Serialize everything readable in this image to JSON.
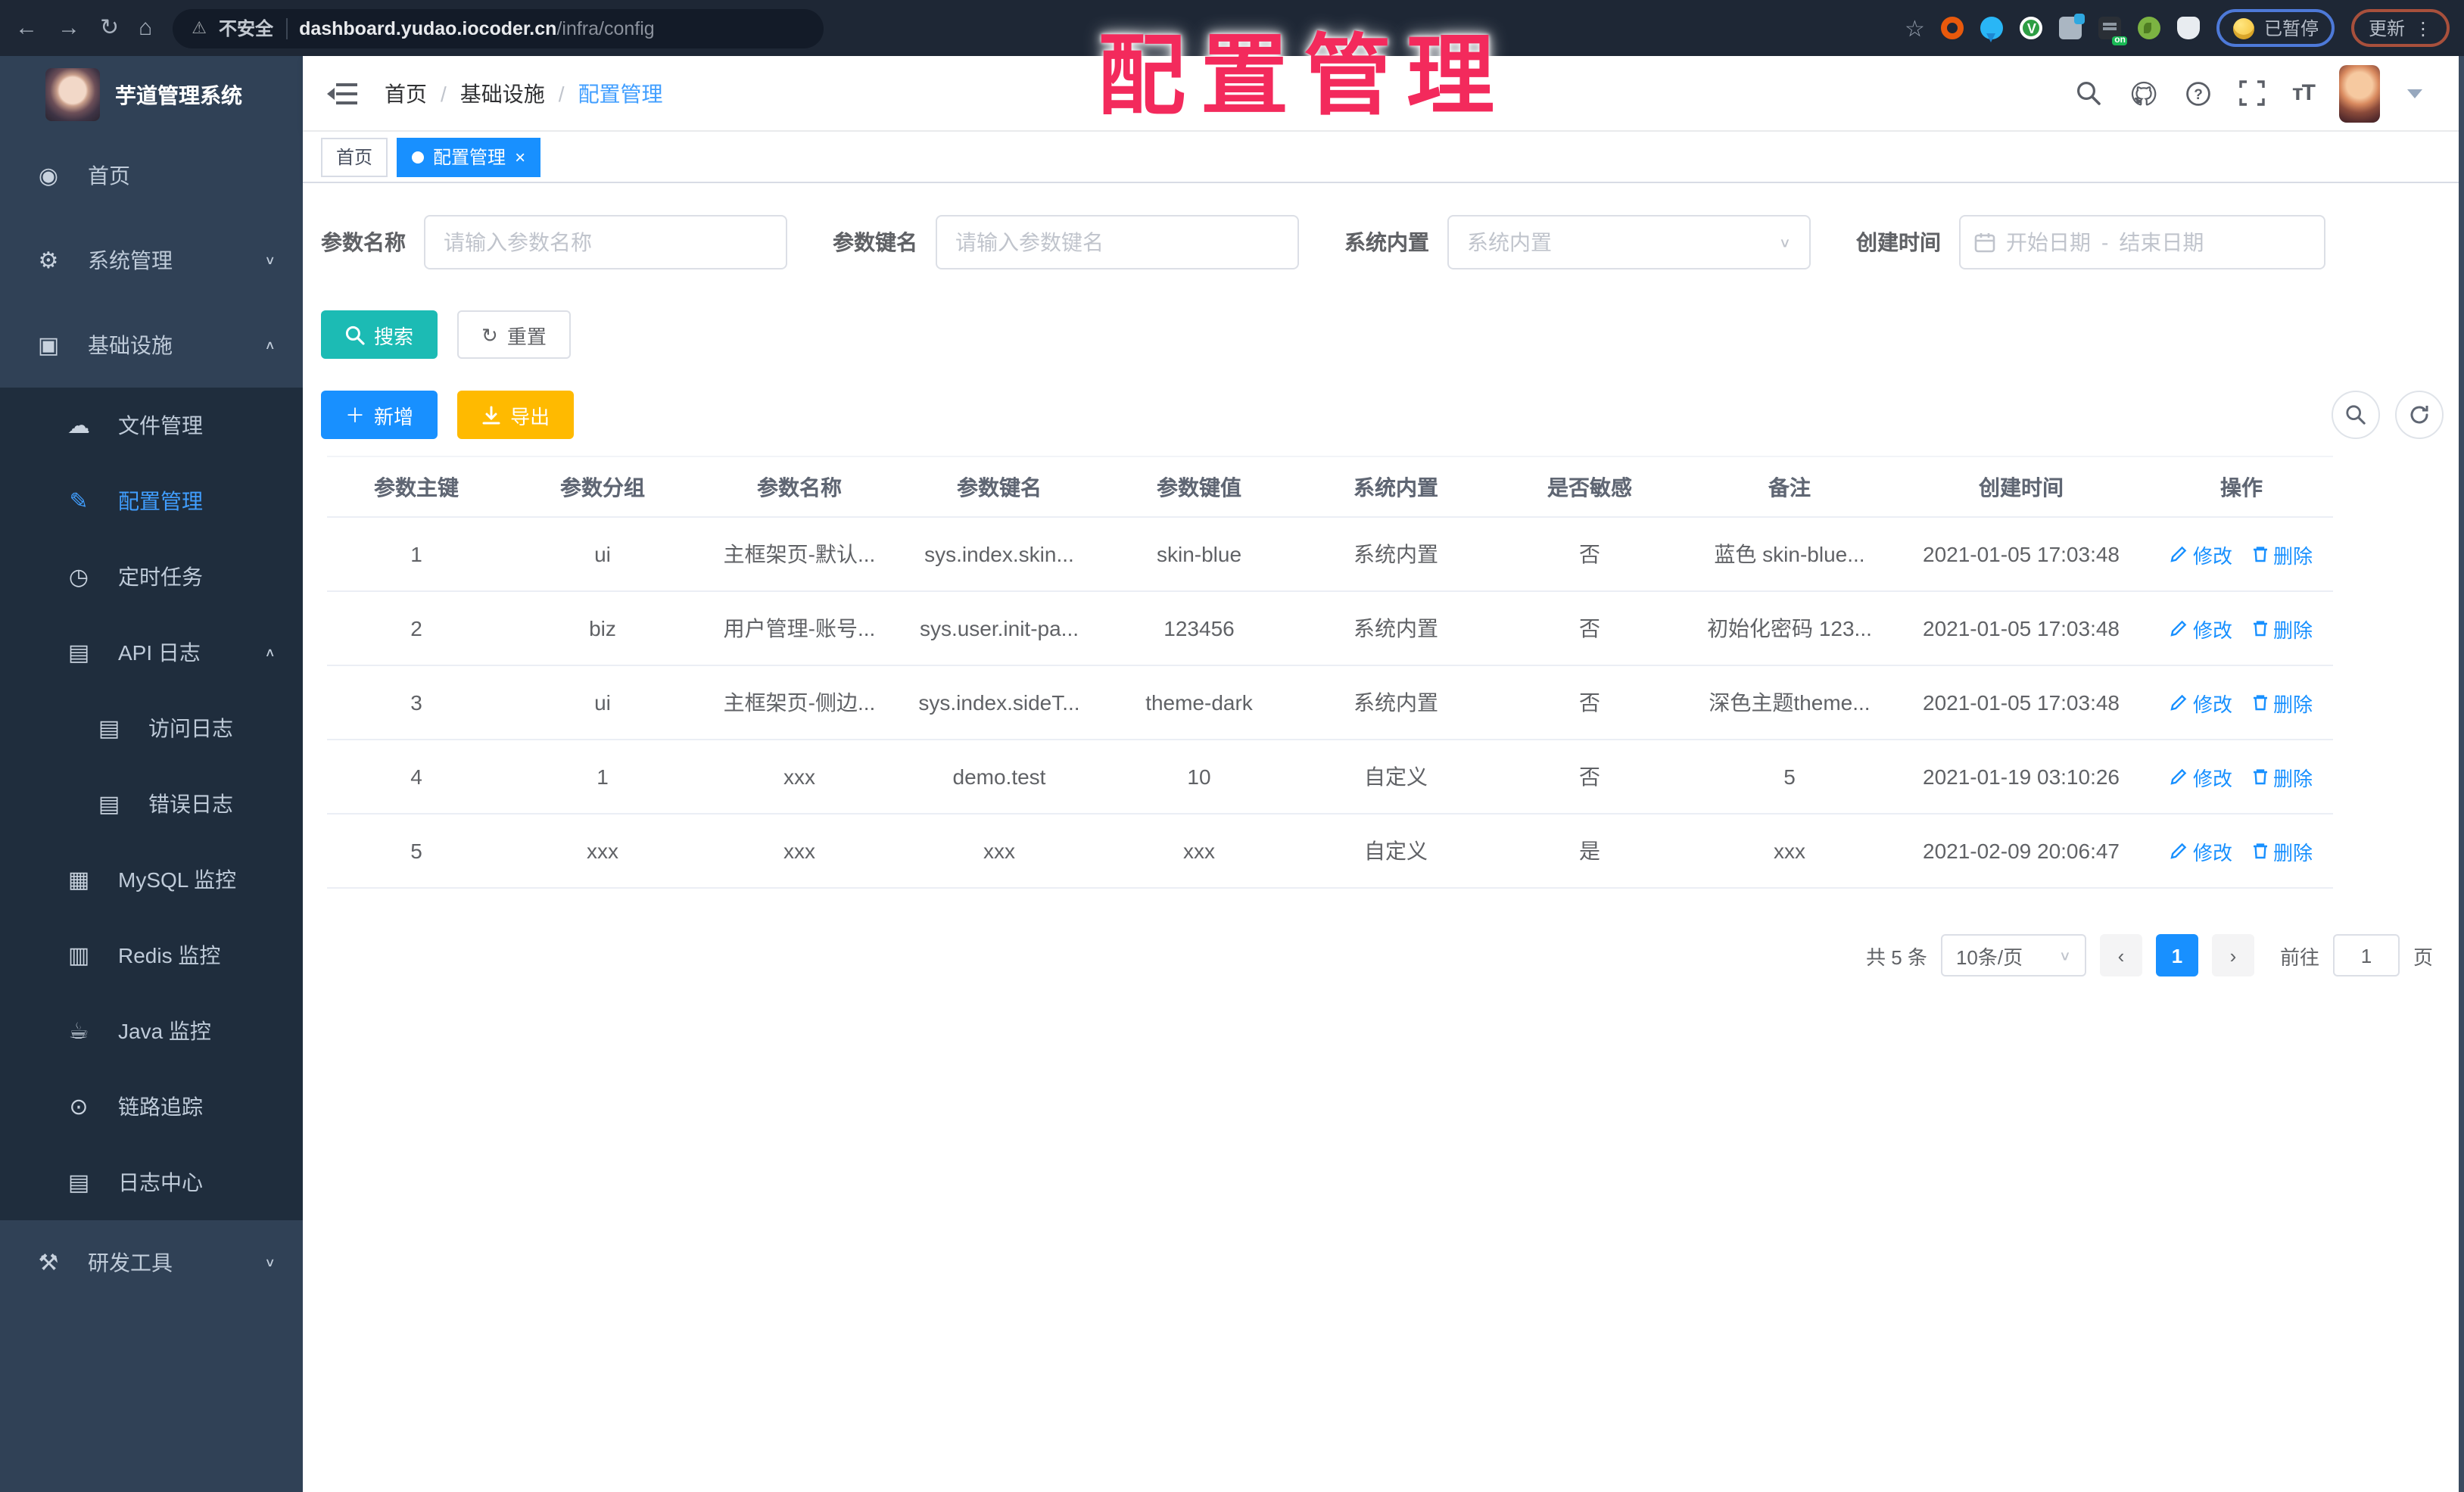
{
  "chrome": {
    "security_label": "不安全",
    "url_host": "dashboard.yudao.iocoder.cn",
    "url_path": "/infra/config",
    "paused_label": "已暂停",
    "update_label": "更新"
  },
  "watermark": "配置管理",
  "colors": {
    "primary": "#1890ff",
    "link": "#409eff",
    "cyan": "#1cbbb4",
    "warning": "#ffba00",
    "sidebar_bg": "#304156",
    "submenu_bg": "#1f2d3d",
    "watermark_red": "#f32a5c"
  },
  "sidebar": {
    "title": "芋道管理系统",
    "items": [
      {
        "key": "home",
        "label": "首页",
        "icon": "dashboard-icon",
        "level": 1
      },
      {
        "key": "system",
        "label": "系统管理",
        "icon": "gear-icon",
        "level": 1,
        "arrow": "down"
      },
      {
        "key": "infra",
        "label": "基础设施",
        "icon": "monitor-icon",
        "level": 1,
        "arrow": "up"
      },
      {
        "key": "file",
        "label": "文件管理",
        "icon": "cloud-icon",
        "level": 2
      },
      {
        "key": "config",
        "label": "配置管理",
        "icon": "edit-icon",
        "level": 2,
        "active": true
      },
      {
        "key": "job",
        "label": "定时任务",
        "icon": "timer-icon",
        "level": 2
      },
      {
        "key": "api-log",
        "label": "API 日志",
        "icon": "log-icon",
        "level": 2,
        "arrow": "up"
      },
      {
        "key": "access-log",
        "label": "访问日志",
        "icon": "log-icon",
        "level": 3
      },
      {
        "key": "error-log",
        "label": "错误日志",
        "icon": "log-icon",
        "level": 3
      },
      {
        "key": "mysql",
        "label": "MySQL 监控",
        "icon": "mysql-icon",
        "level": 2
      },
      {
        "key": "redis",
        "label": "Redis 监控",
        "icon": "redis-icon",
        "level": 2
      },
      {
        "key": "java",
        "label": "Java 监控",
        "icon": "java-icon",
        "level": 2
      },
      {
        "key": "trace",
        "label": "链路追踪",
        "icon": "eye-icon",
        "level": 2
      },
      {
        "key": "log-center",
        "label": "日志中心",
        "icon": "log-icon",
        "level": 2
      },
      {
        "key": "dev-tools",
        "label": "研发工具",
        "icon": "tools-icon",
        "level": 1,
        "arrow": "down"
      }
    ]
  },
  "header": {
    "breadcrumb": [
      "首页",
      "基础设施",
      "配置管理"
    ]
  },
  "tabs": [
    {
      "label": "首页",
      "active": false
    },
    {
      "label": "配置管理",
      "active": true
    }
  ],
  "filters": {
    "name_label": "参数名称",
    "name_placeholder": "请输入参数名称",
    "key_label": "参数键名",
    "key_placeholder": "请输入参数键名",
    "type_label": "系统内置",
    "type_placeholder": "系统内置",
    "date_label": "创建时间",
    "date_start_placeholder": "开始日期",
    "date_separator": "-",
    "date_end_placeholder": "结束日期",
    "search_label": "搜索",
    "reset_label": "重置"
  },
  "toolbar": {
    "add_label": "新增",
    "export_label": "导出"
  },
  "table": {
    "columns": [
      "参数主键",
      "参数分组",
      "参数名称",
      "参数键名",
      "参数键值",
      "系统内置",
      "是否敏感",
      "备注",
      "创建时间",
      "操作"
    ],
    "rows": [
      {
        "id": "1",
        "group": "ui",
        "name": "主框架页-默认...",
        "key": "sys.index.skin...",
        "value": "skin-blue",
        "type": "系统内置",
        "sensitive": "否",
        "remark": "蓝色 skin-blue...",
        "created": "2021-01-05 17:03:48"
      },
      {
        "id": "2",
        "group": "biz",
        "name": "用户管理-账号...",
        "key": "sys.user.init-pa...",
        "value": "123456",
        "type": "系统内置",
        "sensitive": "否",
        "remark": "初始化密码 123...",
        "created": "2021-01-05 17:03:48"
      },
      {
        "id": "3",
        "group": "ui",
        "name": "主框架页-侧边...",
        "key": "sys.index.sideT...",
        "value": "theme-dark",
        "type": "系统内置",
        "sensitive": "否",
        "remark": "深色主题theme...",
        "created": "2021-01-05 17:03:48"
      },
      {
        "id": "4",
        "group": "1",
        "name": "xxx",
        "key": "demo.test",
        "value": "10",
        "type": "自定义",
        "sensitive": "否",
        "remark": "5",
        "created": "2021-01-19 03:10:26"
      },
      {
        "id": "5",
        "group": "xxx",
        "name": "xxx",
        "key": "xxx",
        "value": "xxx",
        "type": "自定义",
        "sensitive": "是",
        "remark": "xxx",
        "created": "2021-02-09 20:06:47"
      }
    ],
    "actions": {
      "edit": "修改",
      "delete": "删除"
    }
  },
  "pagination": {
    "total_label": "共 5 条",
    "page_size": "10条/页",
    "prev_label": "‹",
    "current_page": "1",
    "next_label": "›",
    "goto_label": "前往",
    "goto_value": "1",
    "page_label": "页"
  }
}
